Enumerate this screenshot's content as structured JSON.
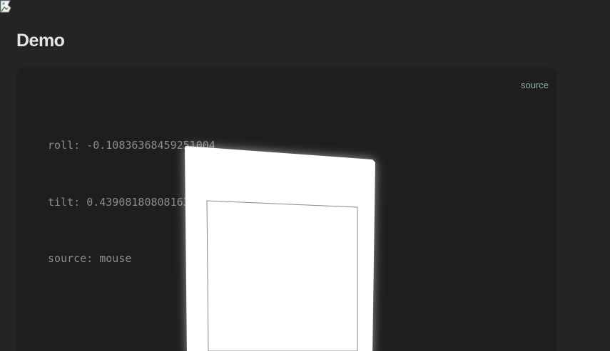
{
  "section": {
    "title": "Demo"
  },
  "demo": {
    "source_link": "source",
    "readout": {
      "roll_label": "roll: ",
      "roll_value": "-0.10836368459251004",
      "tilt_label": "tilt: ",
      "tilt_value": "0.439081808081639",
      "source_label": "source: ",
      "source_value": "mouse"
    },
    "card": {
      "image_state": "broken",
      "icon": "broken-image-icon"
    }
  },
  "colors": {
    "page_bg": "#242424",
    "panel_bg": "#1e1e1e",
    "heading": "#e6e6e6",
    "readout_text": "#8c8c8c",
    "link": "#8fb59a",
    "card": "#ffffff"
  }
}
